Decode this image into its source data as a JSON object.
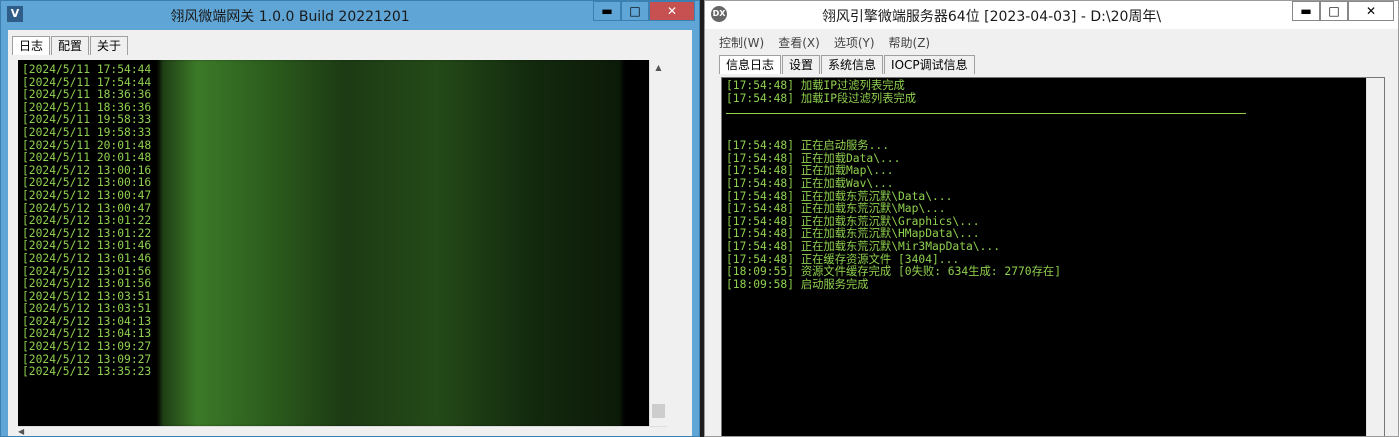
{
  "gateway": {
    "title": "翎风微端网关 1.0.0 Build 20221201",
    "icon_letter": "V",
    "tabs": [
      "日志",
      "配置",
      "关于"
    ],
    "log_lines": [
      "[2024/5/11 17:54:44",
      "[2024/5/11 17:54:44",
      "[2024/5/11 18:36:36",
      "[2024/5/11 18:36:36",
      "[2024/5/11 19:58:33",
      "[2024/5/11 19:58:33",
      "[2024/5/11 20:01:48",
      "[2024/5/11 20:01:48",
      "[2024/5/12 13:00:16",
      "[2024/5/12 13:00:16",
      "[2024/5/12 13:00:47",
      "[2024/5/12 13:00:47",
      "[2024/5/12 13:01:22",
      "[2024/5/12 13:01:22",
      "[2024/5/12 13:01:46",
      "[2024/5/12 13:01:46",
      "[2024/5/12 13:01:56",
      "[2024/5/12 13:01:56",
      "[2024/5/12 13:03:51",
      "[2024/5/12 13:03:51",
      "[2024/5/12 13:04:13",
      "[2024/5/12 13:04:13",
      "[2024/5/12 13:09:27",
      "[2024/5/12 13:09:27",
      "[2024/5/12 13:35:23"
    ]
  },
  "server": {
    "title": "翎风引擎微端服务器64位 [2023-04-03] - D:\\20周年\\",
    "icon_label": "DX",
    "menus": [
      "控制(W)",
      "查看(X)",
      "选项(Y)",
      "帮助(Z)"
    ],
    "tabs": [
      "信息日志",
      "设置",
      "系统信息",
      "IOCP调试信息"
    ],
    "log_top": [
      "[17:54:48] 加载IP过滤列表完成",
      "[17:54:48] 加载IP段过滤列表完成"
    ],
    "log_bottom": [
      "[17:54:48] 正在启动服务...",
      "[17:54:48] 正在加载Data\\...",
      "[17:54:48] 正在加载Map\\...",
      "[17:54:48] 正在加载Wav\\...",
      "[17:54:48] 正在加载东荒沉默\\Data\\...",
      "[17:54:48] 正在加载东荒沉默\\Map\\...",
      "[17:54:48] 正在加载东荒沉默\\Graphics\\...",
      "[17:54:48] 正在加载东荒沉默\\HMapData\\...",
      "[17:54:48] 正在加载东荒沉默\\Mir3MapData\\...",
      "[17:54:48] 正在缓存资源文件 [3404]...",
      "[18:09:55] 资源文件缓存完成 [0失败: 634生成: 2770存在]",
      "[18:09:58] 启动服务完成"
    ]
  },
  "window_controls": {
    "minimize": "▬",
    "maximize": "□",
    "close": "✕"
  },
  "colors": {
    "log_text": "#8fd14f",
    "console_bg": "#000000",
    "gateway_frame": "#5fa5d6"
  }
}
